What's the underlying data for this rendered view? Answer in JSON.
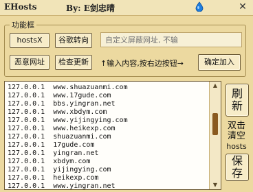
{
  "titlebar": {
    "app_title": "EHosts",
    "byline": "By: E剑忠晴",
    "close_glyph": "✕"
  },
  "group": {
    "label": "功能框",
    "hosts_button": "hostsX",
    "google_button": "谷歌转向",
    "malicious_button": "恶意网址",
    "update_button": "检查更新",
    "url_input_placeholder": "自定义屏蔽网址, 不输",
    "hint": "↑输入内容,按右边按钮→",
    "confirm_button": "确定加入"
  },
  "hosts_list": [
    "127.0.0.1  www.shuazuanmi.com",
    "127.0.0.1  www.17gude.com",
    "127.0.0.1  bbs.yingran.net",
    "127.0.0.1  www.xbdym.com",
    "127.0.0.1  www.yijingying.com",
    "127.0.0.1  www.heikexp.com",
    "127.0.0.1  shuazuanmi.com",
    "127.0.0.1  17gude.com",
    "127.0.0.1  yingran.net",
    "127.0.0.1  xbdym.com",
    "127.0.0.1  yijingying.com",
    "127.0.0.1  heikexp.com",
    "127.0.0.1  www.yingran.net"
  ],
  "side": {
    "refresh_line1": "刷",
    "refresh_line2": "新",
    "clear_line1": "双击",
    "clear_line2": "清空",
    "clear_line3": "hosts",
    "save_line1": "保",
    "save_line2": "存"
  },
  "icons": {
    "title_icon": "droplet-icon",
    "scroll_up": "arrow-up-icon",
    "scroll_down": "arrow-down-icon"
  },
  "colors": {
    "background": "#ecd9a0",
    "scroll_thumb": "#8a5a1f"
  }
}
